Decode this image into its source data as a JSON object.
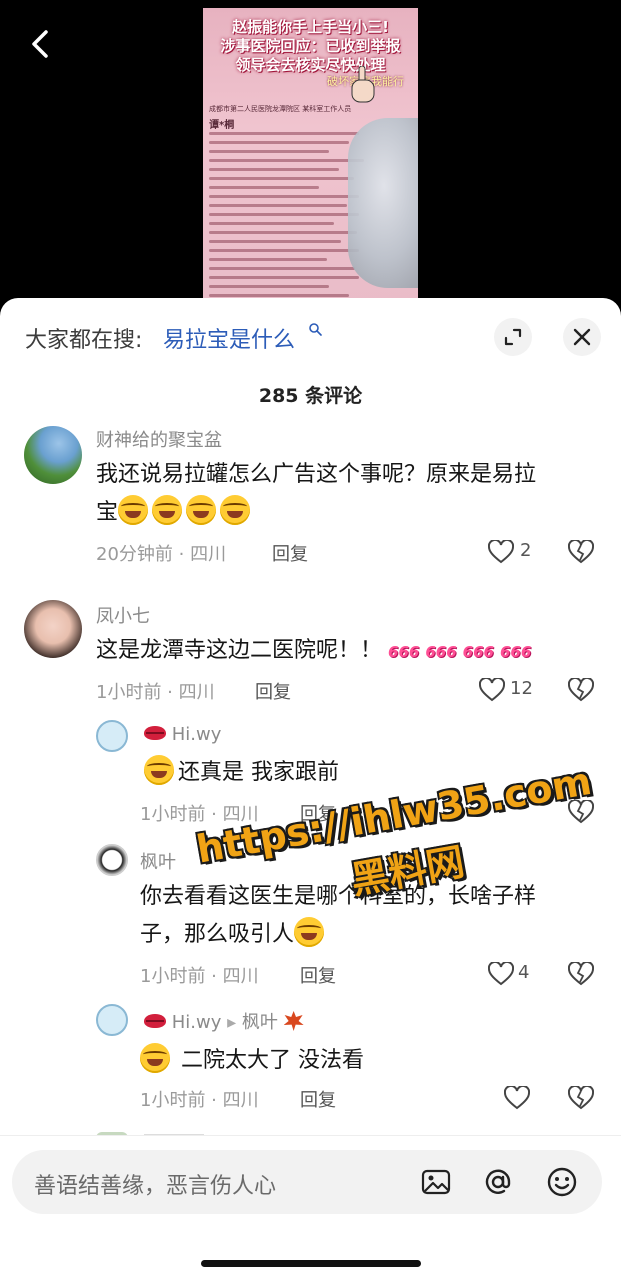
{
  "video": {
    "title_line1": "赵振能你手上手当小三!",
    "title_line2": "涉事医院回应：已收到举报",
    "title_line3": "领导会去核实尽快处理",
    "yellow_caption": "破坏家庭我能行",
    "org": "成都市第二人民医院龙潭院区 某科室工作人员",
    "name": "谭*桐"
  },
  "search": {
    "prefix": "大家都在搜:",
    "term": "易拉宝是什么"
  },
  "comment_count": "285 条评论",
  "comments": [
    {
      "user": "财神给的聚宝盆",
      "text": "我还说易拉罐怎么广告这个事呢？原来是易拉",
      "text2": "宝",
      "time": "20分钟前 · 四川",
      "reply": "回复",
      "likes": "2"
    },
    {
      "user": "凤小七",
      "text": "这是龙潭寺这边二医院呢！！",
      "tags": [
        "666",
        "666",
        "666",
        "666"
      ],
      "time": "1小时前 · 四川",
      "reply": "回复",
      "likes": "12"
    },
    {
      "user": "Hi.wy",
      "text": "还真是 我家跟前",
      "time": "1小时前 · 四川",
      "reply": "回复",
      "likes": "4"
    },
    {
      "user": "枫叶",
      "reply_to": "Hi.wy",
      "text": "你去看看这医生是哪个科室的，长啥子样",
      "text2": "子，那么吸引人",
      "time": "1小时前 · 四川",
      "reply": "回复",
      "likes": "4"
    },
    {
      "user": "Hi.wy",
      "reply_to": "枫叶",
      "text": "二院太大了 没法看",
      "time": "1小时前 · 四川",
      "reply": "回复",
      "likes": ""
    }
  ],
  "watermark": {
    "url": "https://ihlw35.com",
    "label": "黑料网"
  },
  "input": {
    "placeholder": "善语结善缘，恶言伤人心"
  }
}
